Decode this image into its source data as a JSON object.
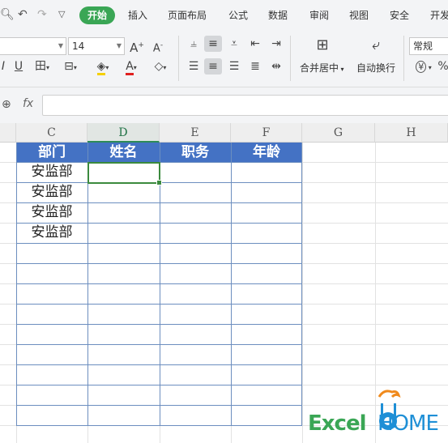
{
  "menu": {
    "tabs": [
      "开始",
      "插入",
      "页面布局",
      "公式",
      "数据",
      "审阅",
      "视图",
      "安全",
      "开发"
    ],
    "active": "开始"
  },
  "ribbon": {
    "font_size": "14",
    "font_name": "",
    "merge_center_label": "合并居中",
    "wrap_text_label": "自动换行",
    "number_format": "常规",
    "currency_symbol": "¥"
  },
  "formula_bar": {
    "fx_label": "fx",
    "content": ""
  },
  "columns": [
    "C",
    "D",
    "E",
    "F",
    "G",
    "H"
  ],
  "active_column": "D",
  "table": {
    "headers": [
      "部门",
      "姓名",
      "职务",
      "年龄"
    ],
    "rows": [
      [
        "安监部",
        "",
        "",
        ""
      ],
      [
        "安监部",
        "",
        "",
        ""
      ],
      [
        "安监部",
        "",
        "",
        ""
      ],
      [
        "安监部",
        "",
        "",
        ""
      ],
      [
        "",
        "",
        "",
        ""
      ],
      [
        "",
        "",
        "",
        ""
      ],
      [
        "",
        "",
        "",
        ""
      ],
      [
        "",
        "",
        "",
        ""
      ],
      [
        "",
        "",
        "",
        ""
      ],
      [
        "",
        "",
        "",
        ""
      ],
      [
        "",
        "",
        "",
        ""
      ],
      [
        "",
        "",
        "",
        ""
      ],
      [
        "",
        "",
        "",
        ""
      ]
    ]
  },
  "colors": {
    "accent_green": "#3aa655",
    "header_blue": "#4472c4",
    "table_border": "#6c8ebf"
  },
  "watermark": {
    "text_excel": "Excel",
    "text_home": "HOME"
  }
}
